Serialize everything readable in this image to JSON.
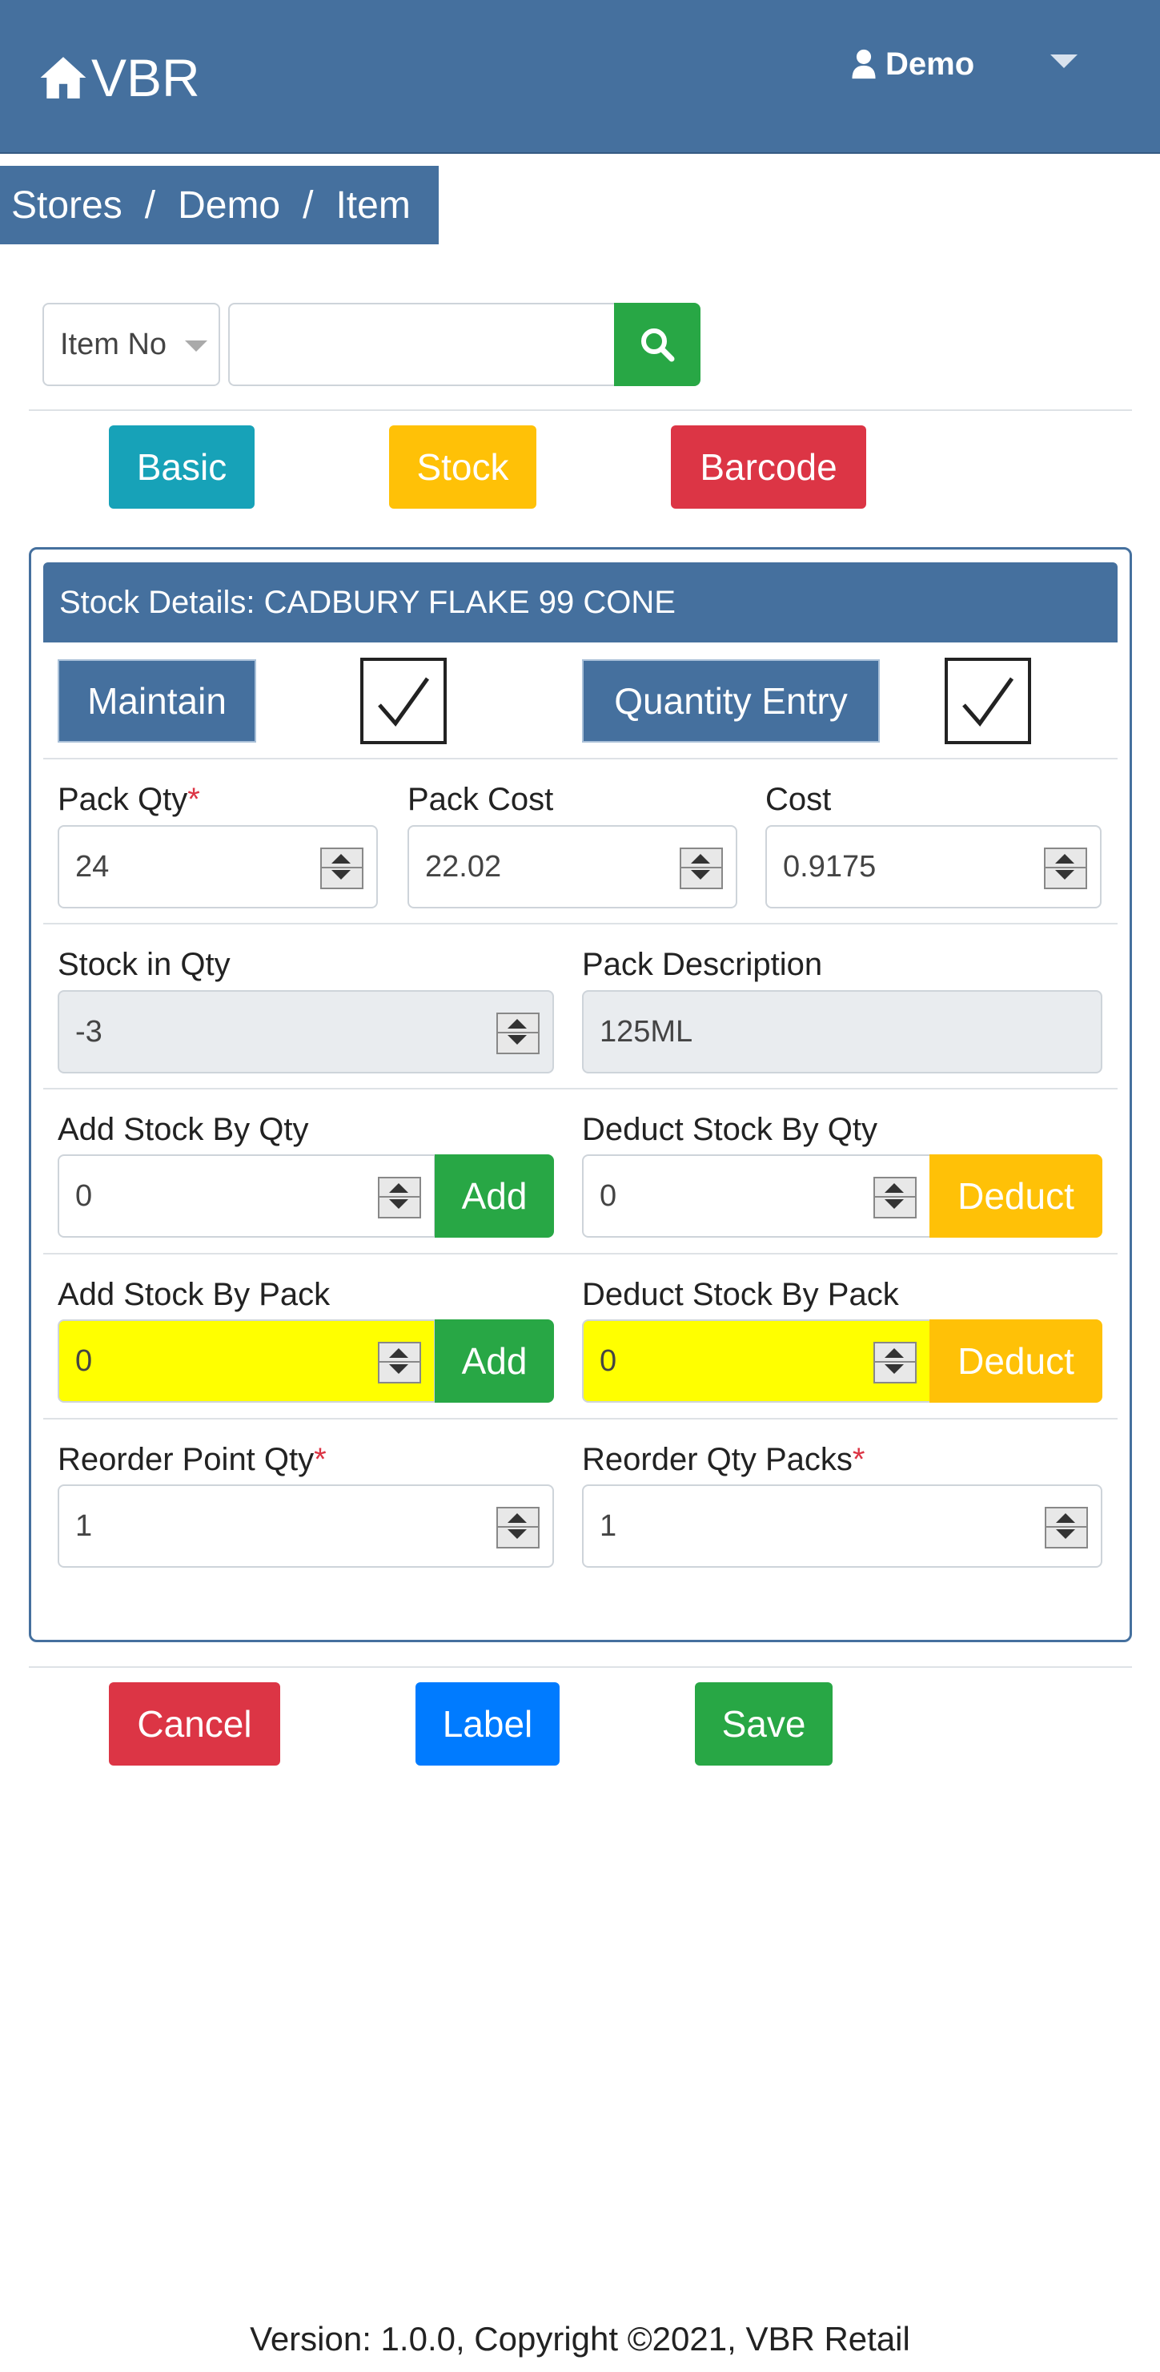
{
  "header": {
    "brand": "VBR",
    "user": "Demo"
  },
  "breadcrumb": [
    "Stores",
    "Demo",
    "Item"
  ],
  "search": {
    "select_value": "Item No",
    "input_value": "",
    "input_placeholder": ""
  },
  "tabs": {
    "basic": "Basic",
    "stock": "Stock",
    "barcode": "Barcode"
  },
  "card": {
    "title": "Stock Details: CADBURY FLAKE 99 CONE",
    "maintain_label": "Maintain",
    "maintain_checked": true,
    "quantity_entry_label": "Quantity Entry",
    "quantity_entry_checked": true
  },
  "fields": {
    "pack_qty": {
      "label": "Pack Qty",
      "value": "24"
    },
    "pack_cost": {
      "label": "Pack Cost",
      "value": "22.02"
    },
    "cost": {
      "label": "Cost",
      "value": "0.9175"
    },
    "stock_in_qty": {
      "label": "Stock in Qty",
      "value": "-3"
    },
    "pack_description": {
      "label": "Pack Description",
      "value": "125ML"
    },
    "add_stock_qty": {
      "label": "Add Stock By Qty",
      "value": "0",
      "button": "Add"
    },
    "deduct_stock_qty": {
      "label": "Deduct Stock By Qty",
      "value": "0",
      "button": "Deduct"
    },
    "add_stock_pack": {
      "label": "Add Stock By Pack",
      "value": "0",
      "button": "Add"
    },
    "deduct_stock_pack": {
      "label": "Deduct Stock By Pack",
      "value": "0",
      "button": "Deduct"
    },
    "reorder_point_qty": {
      "label": "Reorder Point Qty",
      "value": "1"
    },
    "reorder_qty_packs": {
      "label": "Reorder Qty Packs",
      "value": "1"
    }
  },
  "required_mark": "*",
  "actions": {
    "cancel": "Cancel",
    "label": "Label",
    "save": "Save"
  },
  "footer": "Version: 1.0.0, Copyright ©2021, VBR Retail",
  "colors": {
    "header": "#45709e",
    "success": "#28a745",
    "warning": "#ffc107",
    "danger": "#dc3545",
    "info": "#17a2b8",
    "primary": "#007bff",
    "highlight": "#ffff00"
  }
}
